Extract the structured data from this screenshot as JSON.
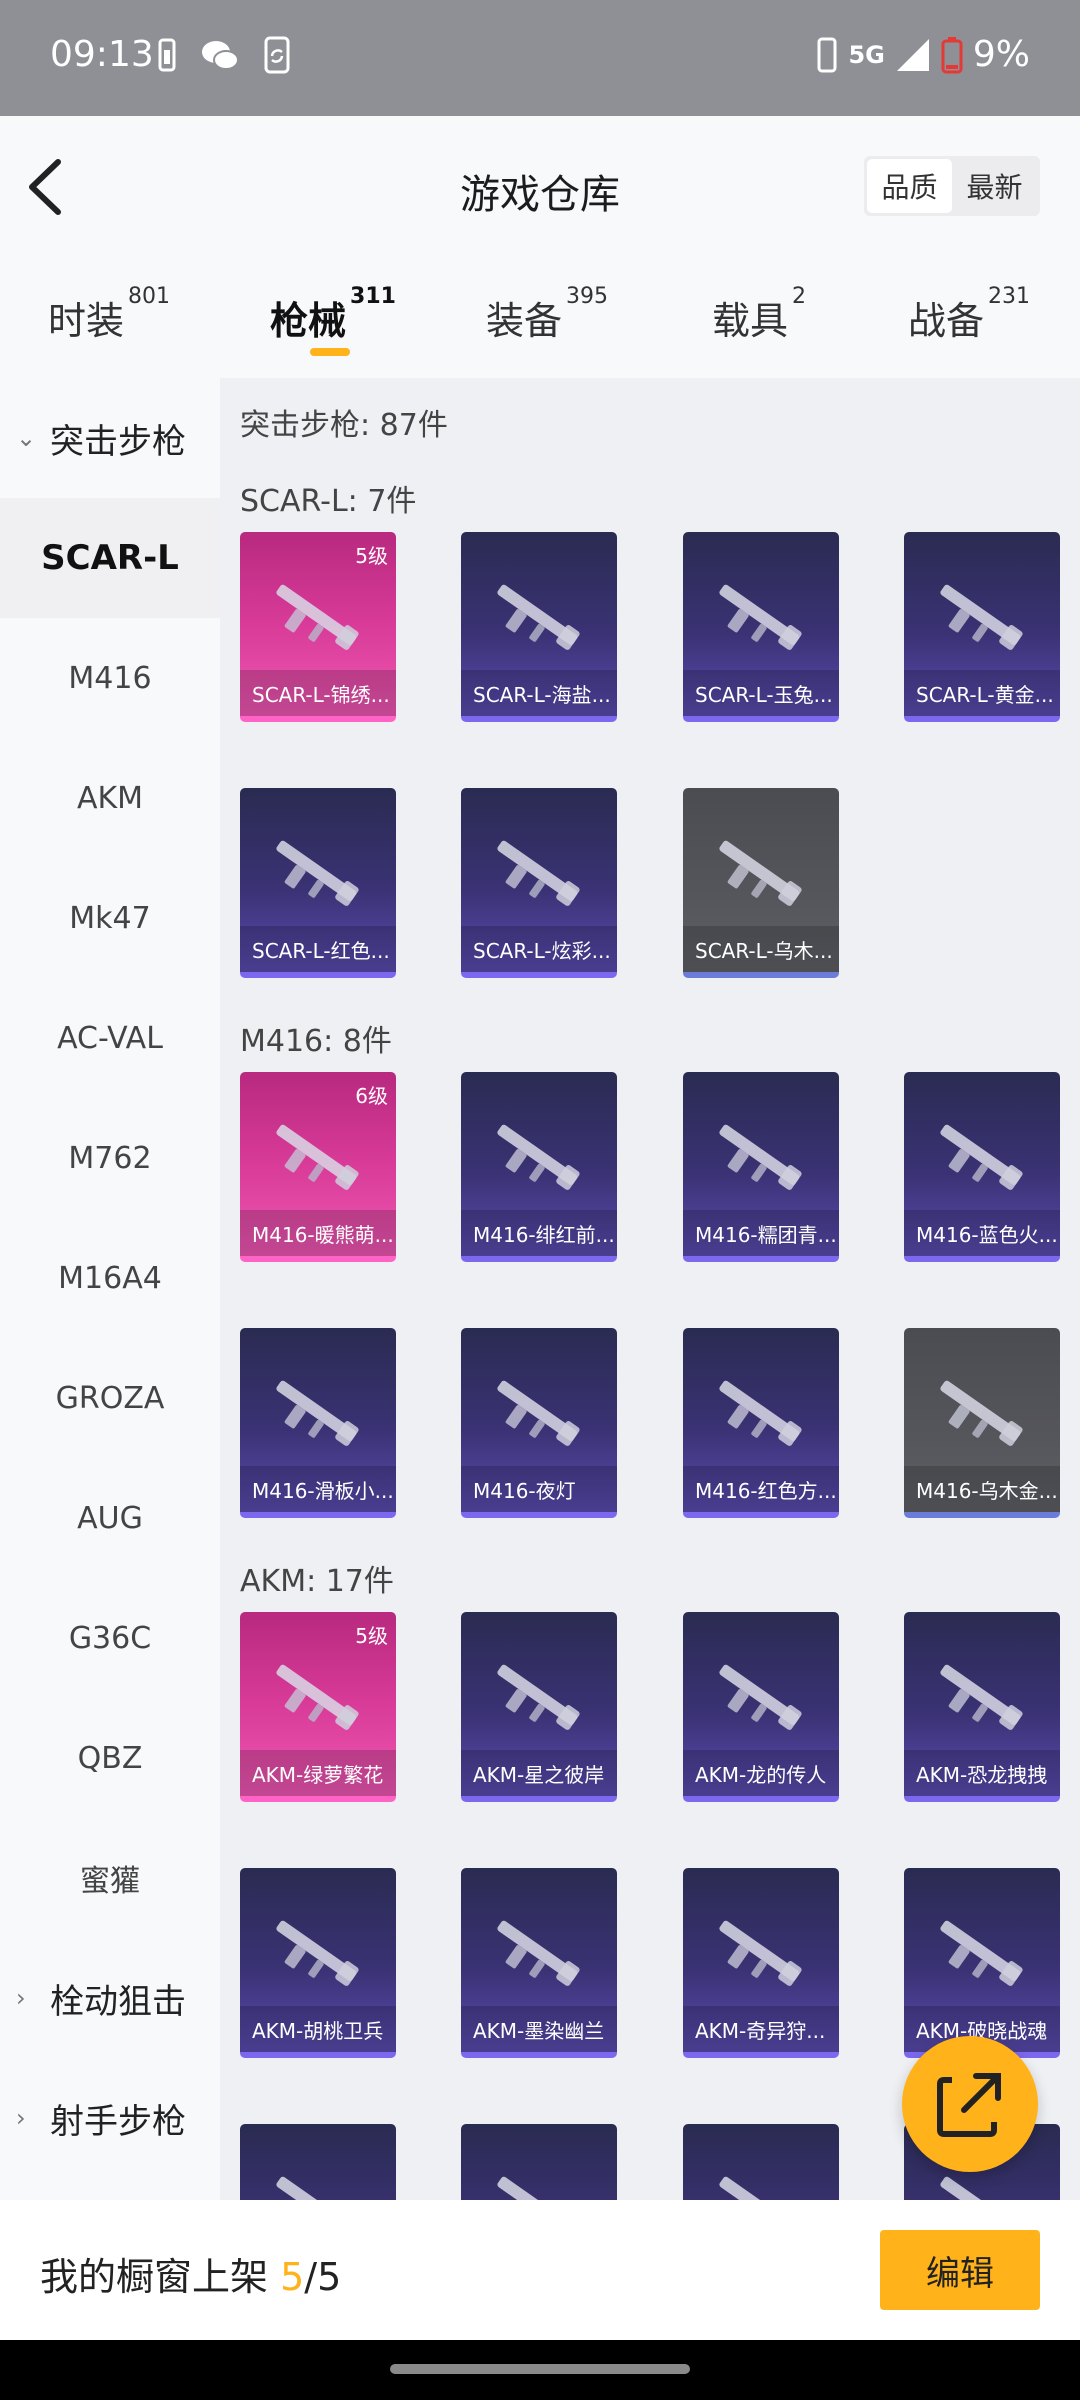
{
  "status_bar": {
    "time": "09:13",
    "network": "5G",
    "battery": "9%"
  },
  "header": {
    "title": "游戏仓库",
    "sort_options": [
      "品质",
      "最新"
    ]
  },
  "tabs": [
    {
      "label": "时装",
      "count": "801"
    },
    {
      "label": "枪械",
      "count": "311"
    },
    {
      "label": "装备",
      "count": "395"
    },
    {
      "label": "载具",
      "count": "2"
    },
    {
      "label": "战备",
      "count": "231"
    }
  ],
  "sidebar": {
    "group_open": "突击步枪",
    "items": [
      "SCAR-L",
      "M416",
      "AKM",
      "Mk47",
      "AC-VAL",
      "M762",
      "M16A4",
      "GROZA",
      "AUG",
      "G36C",
      "QBZ",
      "蜜獾"
    ],
    "groups_closed": [
      "栓动狙击",
      "射手步枪"
    ]
  },
  "content": {
    "category_title": "突击步枪: 87件",
    "sections": [
      {
        "title": "SCAR-L: 7件",
        "items": [
          {
            "name": "SCAR-L-锦绣...",
            "level": "5级",
            "rarity": "pink"
          },
          {
            "name": "SCAR-L-海盐...",
            "rarity": "purple"
          },
          {
            "name": "SCAR-L-玉兔...",
            "rarity": "purple"
          },
          {
            "name": "SCAR-L-黄金...",
            "rarity": "purple"
          },
          {
            "name": "SCAR-L-红色...",
            "rarity": "purple"
          },
          {
            "name": "SCAR-L-炫彩...",
            "rarity": "purple"
          },
          {
            "name": "SCAR-L-乌木...",
            "rarity": "grey"
          }
        ]
      },
      {
        "title": "M416: 8件",
        "items": [
          {
            "name": "M416-暖熊萌...",
            "level": "6级",
            "rarity": "pink"
          },
          {
            "name": "M416-绯红前...",
            "rarity": "purple"
          },
          {
            "name": "M416-糯团青...",
            "rarity": "purple"
          },
          {
            "name": "M416-蓝色火...",
            "rarity": "purple"
          },
          {
            "name": "M416-滑板小...",
            "rarity": "purple"
          },
          {
            "name": "M416-夜灯",
            "rarity": "purple"
          },
          {
            "name": "M416-红色方...",
            "rarity": "purple"
          },
          {
            "name": "M416-乌木金...",
            "rarity": "grey"
          }
        ]
      },
      {
        "title": "AKM: 17件",
        "items": [
          {
            "name": "AKM-绿萝繁花",
            "level": "5级",
            "rarity": "pink"
          },
          {
            "name": "AKM-星之彼岸",
            "rarity": "purple"
          },
          {
            "name": "AKM-龙的传人",
            "rarity": "purple"
          },
          {
            "name": "AKM-恐龙拽拽",
            "rarity": "purple"
          },
          {
            "name": "AKM-胡桃卫兵",
            "rarity": "purple"
          },
          {
            "name": "AKM-墨染幽兰",
            "rarity": "purple"
          },
          {
            "name": "AKM-奇异狩...",
            "rarity": "purple"
          },
          {
            "name": "AKM-破晓战魂",
            "rarity": "purple"
          },
          {
            "name": "",
            "rarity": "purple"
          },
          {
            "name": "",
            "rarity": "purple"
          },
          {
            "name": "",
            "rarity": "purple"
          },
          {
            "name": "",
            "rarity": "purple"
          }
        ]
      }
    ]
  },
  "bottom_bar": {
    "label": "我的橱窗上架 ",
    "shelved": "5",
    "capacity": "/5",
    "edit_label": "编辑"
  },
  "colors": {
    "accent": "#ffb21a",
    "pink": "#d83b98",
    "purple": "#3a3274",
    "grey": "#55565c"
  }
}
